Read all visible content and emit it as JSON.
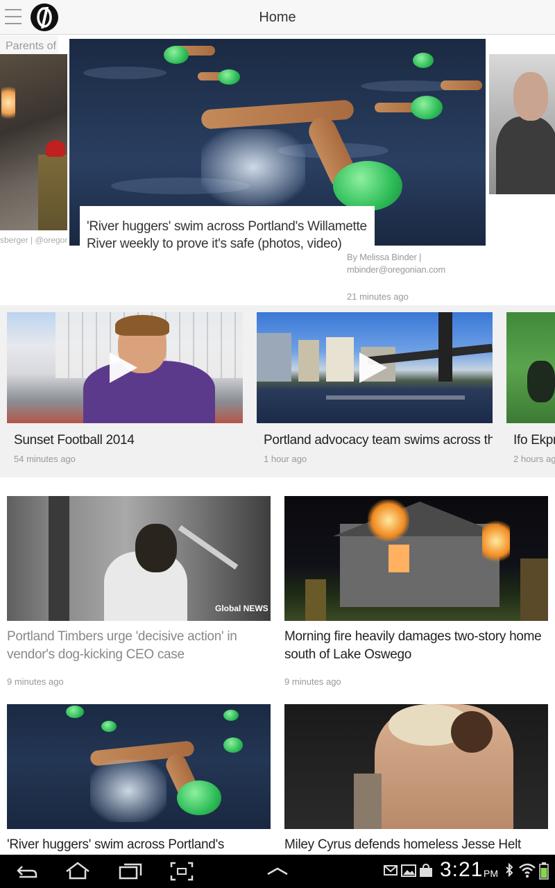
{
  "actionbar": {
    "title": "Home",
    "menu_icon": "hamburger-icon",
    "logo_icon": "oregonian-logo"
  },
  "carousel": {
    "left": {
      "credit": "sberger | @oregonian.com"
    },
    "hero": {
      "headline": "'River huggers' swim across Portland's Willamette River weekly to prove it's safe (photos, video)",
      "byline_name": "By Melissa Binder |",
      "byline_email": "mbinder@oregonian.com",
      "time": "21 minutes ago"
    },
    "right": {
      "caption": "Parents of W file wrongfu"
    }
  },
  "videos": [
    {
      "title": "Sunset Football 2014",
      "time": "54 minutes ago"
    },
    {
      "title": "Portland advocacy team swims across th...",
      "time": "1 hour ago"
    },
    {
      "title": "Ifo Ekpr",
      "time": "2 hours ago"
    }
  ],
  "articles": [
    {
      "title": "Portland Timbers urge 'decisive action' in vendor's dog-kicking CEO case",
      "time": "9 minutes ago",
      "read": true,
      "watermark": "Global NEWS"
    },
    {
      "title": "Morning fire heavily damages two-story home south of Lake Oswego",
      "time": "9 minutes ago",
      "read": false
    },
    {
      "title": "'River huggers' swim across Portland's Willamette",
      "time": "",
      "read": false
    },
    {
      "title": "Miley Cyrus defends homeless Jesse Helt while",
      "time": "",
      "read": false
    }
  ],
  "system_bar": {
    "time": "3:21",
    "ampm": "PM"
  },
  "colors": {
    "accent": "#2ebd58",
    "action_bar": "#f7f7f7",
    "strip_bg": "#f1f1f1"
  }
}
